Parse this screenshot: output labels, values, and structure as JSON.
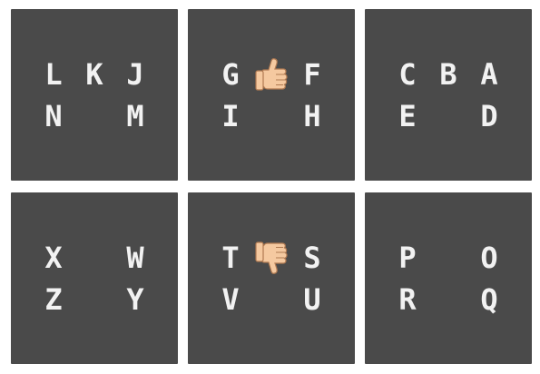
{
  "tiles": [
    {
      "row1": [
        "L",
        "K",
        "J"
      ],
      "row2": [
        "N",
        "",
        "M"
      ]
    },
    {
      "row1": [
        "G",
        "",
        "F"
      ],
      "row2": [
        "I",
        "",
        "H"
      ],
      "icon": "thumbs-up"
    },
    {
      "row1": [
        "C",
        "B",
        "A"
      ],
      "row2": [
        "E",
        "",
        "D"
      ]
    },
    {
      "row1": [
        "X",
        "",
        "W"
      ],
      "row2": [
        "Z",
        "",
        "Y"
      ]
    },
    {
      "row1": [
        "T",
        "",
        "S"
      ],
      "row2": [
        "V",
        "",
        "U"
      ],
      "icon": "thumbs-down"
    },
    {
      "row1": [
        "P",
        "",
        "O"
      ],
      "row2": [
        "R",
        "",
        "Q"
      ]
    }
  ],
  "colors": {
    "tile": "#4a4a4a",
    "letter": "#f2f2f2",
    "thumb": "#f5c9a0"
  }
}
